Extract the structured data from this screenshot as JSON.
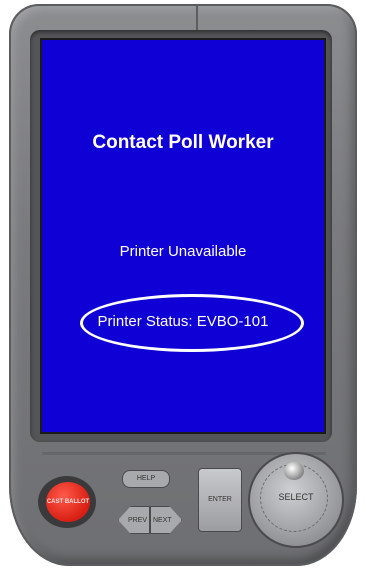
{
  "screen": {
    "title": "Contact Poll Worker",
    "message": "Printer Unavailable",
    "status": "Printer Status: EVBO-101"
  },
  "buttons": {
    "cast_ballot": "CAST BALLOT",
    "help": "HELP",
    "prev": "PREV",
    "next": "NEXT",
    "enter": "ENTER",
    "select": "SELECT"
  },
  "colors": {
    "screen_bg": "#0f00d6",
    "text": "#ffffff",
    "cast_button": "#d81e12",
    "device_body": "#7a7b7e"
  }
}
